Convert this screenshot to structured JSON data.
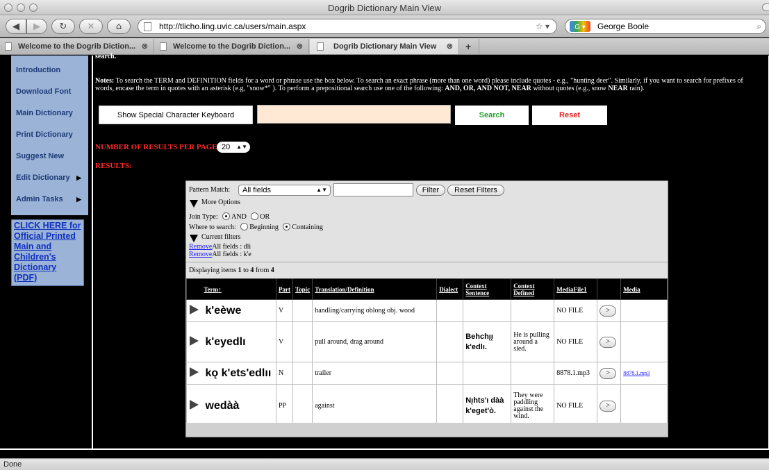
{
  "window": {
    "title": "Dogrib Dictionary Main View"
  },
  "browser": {
    "url": "http://tlicho.ling.uvic.ca/users/main.aspx",
    "search_engine_text": "George Boole",
    "tabs": [
      {
        "label": "Welcome to the Dogrib Diction..."
      },
      {
        "label": "Welcome to the Dogrib Diction..."
      },
      {
        "label": "Dogrib Dictionary Main View"
      }
    ],
    "status": "Done"
  },
  "sidebar": {
    "items": [
      {
        "label": "Introduction"
      },
      {
        "label": "Download Font"
      },
      {
        "label": "Main Dictionary"
      },
      {
        "label": "Print Dictionary"
      },
      {
        "label": "Suggest New"
      },
      {
        "label": "Edit Dictionary"
      },
      {
        "label": "Admin Tasks"
      }
    ],
    "pdf_link": "CLICK HERE for Official Printed Main and Children's Dictionary (PDF)"
  },
  "search": {
    "cut_heading": "search.",
    "notes_label": "Notes:",
    "notes_text": "To search the TERM and DEFINITION fields for a word or phrase use the box below. To search an exact phrase (more than one word) please include quotes - e.g., \"hunting deer\". Similarly, if you want to search for prefixes of words, encase the term in quotes with an asterisk (e.g, \"snow*\" ). To perform a prepositional search use one of the following:",
    "notes_ops": "AND, OR, AND NOT, NEAR",
    "notes_tail": "without quotes (e.g., snow",
    "notes_near": "NEAR",
    "notes_end": "rain).",
    "keyboard_button": "Show Special Character Keyboard",
    "search_button": "Search",
    "reset_button": "Reset",
    "results_per_page_label": "NUMBER OF RESULTS PER PAGE:",
    "results_per_page": "20",
    "results_label": "RESULTS:"
  },
  "grid": {
    "pattern_match_label": "Pattern Match:",
    "pattern_match_value": "All fields",
    "filter_button": "Filter",
    "reset_filters_button": "Reset Filters",
    "more_options": "More Options",
    "join_type_label": "Join Type:",
    "join_and": "AND",
    "join_or": "OR",
    "where_label": "Where to search:",
    "where_beginning": "Beginning",
    "where_containing": "Containing",
    "current_filters": "Current filters",
    "filters": [
      {
        "remove": "Remove",
        "text": "All fields : dli"
      },
      {
        "remove": "Remove",
        "text": "All fields : k'e"
      }
    ],
    "display_prefix": "Displaying items",
    "display_from": "1",
    "display_to_word": "to",
    "display_to": "4",
    "display_of_word": "from",
    "display_total": "4",
    "columns": [
      "Term",
      "Part",
      "Topic",
      "Translation/Definition",
      "Dialect",
      "Context Sentence",
      "Context Defined",
      "MediaFile1",
      "",
      "Media"
    ],
    "sort_arrow": "↑",
    "rows": [
      {
        "term": "k'eèwe",
        "part": "V",
        "topic": "",
        "definition": "handling/carrying oblong obj. wood",
        "dialect": "",
        "context_sentence": "",
        "context_defined": "",
        "mediafile": "NO FILE",
        "play": ">",
        "media": ""
      },
      {
        "term": "k'eyedlı",
        "part": "V",
        "topic": "",
        "definition": "pull around, drag around",
        "dialect": "",
        "context_sentence": "Behchı̨ı̨ k'edlı.",
        "context_defined": "He is pulling around a sled.",
        "mediafile": "NO FILE",
        "play": ">",
        "media": ""
      },
      {
        "term": "kǫ k'ets'edlıı",
        "part": "N",
        "topic": "",
        "definition": "trailer",
        "dialect": "",
        "context_sentence": "",
        "context_defined": "",
        "mediafile": "8878.1.mp3",
        "play": ">",
        "media": "8878.1.mp3"
      },
      {
        "term": "wedàà",
        "part": "PP",
        "topic": "",
        "definition": "against",
        "dialect": "",
        "context_sentence": "Nı̨hts'ı dàà k'eget'ò.",
        "context_defined": "They were paddling against the wind.",
        "mediafile": "NO FILE",
        "play": ">",
        "media": ""
      }
    ]
  }
}
